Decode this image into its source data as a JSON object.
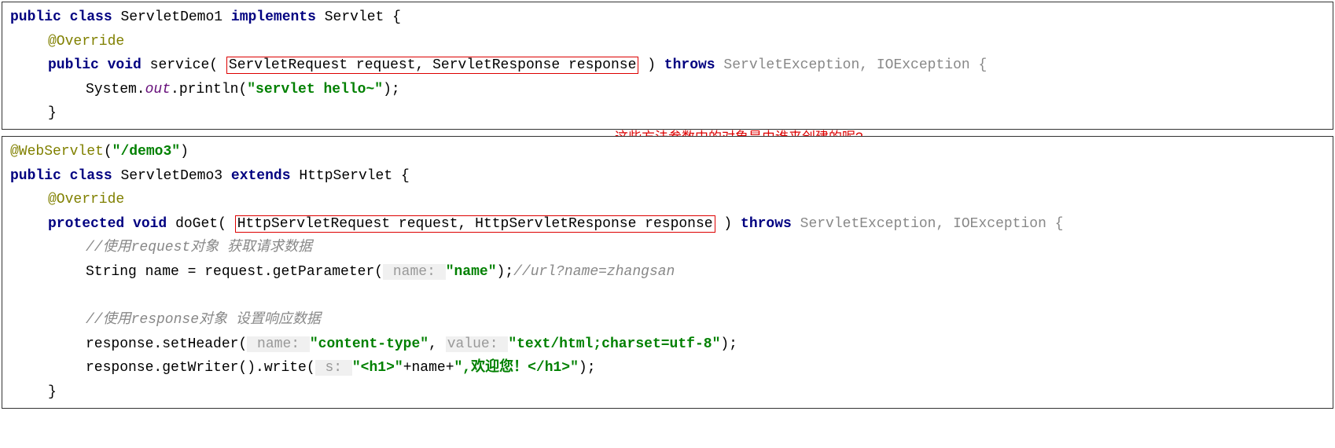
{
  "box1": {
    "line1_kw1": "public",
    "line1_kw2": "class",
    "line1_name": " ServletDemo1 ",
    "line1_kw3": "implements",
    "line1_type": " Servlet {",
    "blank": " ",
    "override": "@Override",
    "svc_kw1": "public",
    "svc_kw2": " void",
    "svc_name": " service(",
    "svc_params": "ServletRequest request, ServletResponse response",
    "svc_close": ") ",
    "svc_throws": "throws",
    "svc_ex": " ServletException, IOException {",
    "sysout_a": "System.",
    "sysout_out": "out",
    "sysout_b": ".println(",
    "sysout_str": "\"servlet hello~\"",
    "sysout_c": ");",
    "close1": "}"
  },
  "callout_text": "这些方法参数中的对象是由谁来创建的呢?",
  "box2": {
    "ws_ann": "@WebServlet",
    "ws_paren": "(",
    "ws_url": "\"/demo3\"",
    "ws_paren2": ")",
    "cls_kw1": "public",
    "cls_kw2": "class",
    "cls_name": " ServletDemo3 ",
    "cls_kw3": "extends",
    "cls_type": " HttpServlet {",
    "override": "@Override",
    "dg_kw1": "protected",
    "dg_kw2": " void",
    "dg_name": " doGet(",
    "dg_params": "HttpServletRequest request, HttpServletResponse response",
    "dg_close": ") ",
    "dg_throws": "throws",
    "dg_ex": " ServletException, IOException {",
    "cmt1": "//使用request对象 获取请求数据",
    "gp_a": "String name = request.getParameter(",
    "gp_hint": " name: ",
    "gp_str": "\"name\"",
    "gp_b": ");",
    "gp_cmt": "//url?name=zhangsan",
    "cmt2": "//使用response对象 设置响应数据",
    "sh_a": "response.setHeader(",
    "sh_hint1": " name: ",
    "sh_str1": "\"content-type\"",
    "sh_comma": ", ",
    "sh_hint2": " value: ",
    "sh_str2": "\"text/html;charset=utf-8\"",
    "sh_b": ");",
    "wr_a": "response.getWriter().write(",
    "wr_hint": " s: ",
    "wr_str1": "\"<h1>\"",
    "wr_plus1": "+name+",
    "wr_str2": "\",欢迎您！</h1>\"",
    "wr_b": ");",
    "close1": "}"
  }
}
